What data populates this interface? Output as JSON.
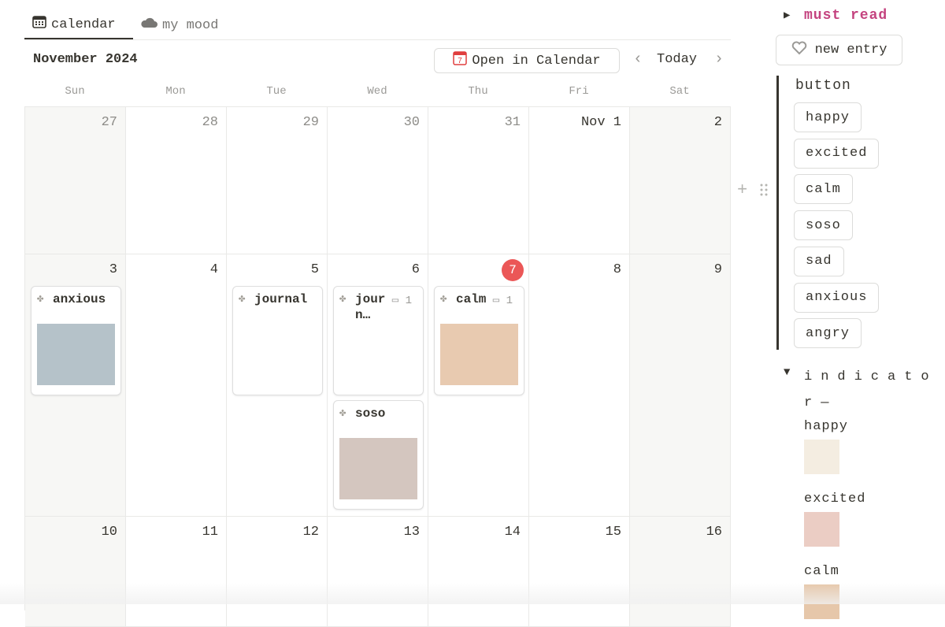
{
  "tabs": [
    {
      "label": "calendar",
      "icon": "calendar-icon",
      "active": true
    },
    {
      "label": "my mood",
      "icon": "cloud-icon",
      "active": false
    }
  ],
  "header": {
    "month": "November 2024",
    "open_label": "Open in Calendar",
    "today_label": "Today"
  },
  "weekdays": [
    "Sun",
    "Mon",
    "Tue",
    "Wed",
    "Thu",
    "Fri",
    "Sat"
  ],
  "weeks": [
    [
      "27",
      "28",
      "29",
      "30",
      "31",
      "Nov 1",
      "2"
    ],
    [
      "3",
      "4",
      "5",
      "6",
      "7",
      "8",
      "9"
    ],
    [
      "10",
      "11",
      "12",
      "13",
      "14",
      "15",
      "16"
    ]
  ],
  "today": "7",
  "entries": [
    {
      "title": "anxious",
      "color": "#b5c2c9"
    },
    {
      "title": "journal"
    },
    {
      "title": "journ…",
      "comments": "1"
    },
    {
      "title": "soso",
      "color": "#d4c6bf"
    },
    {
      "title": "calm",
      "comments": "1",
      "color": "#e8cab0"
    }
  ],
  "side": {
    "must_read": "must read",
    "must_read_color": "#c4437f",
    "new_entry": "new entry",
    "button_heading": "button",
    "moods": [
      "happy",
      "excited",
      "calm",
      "soso",
      "sad",
      "anxious",
      "angry"
    ],
    "indicator_heading": "indicator—",
    "indicators": [
      {
        "label": "happy",
        "color": "#f4ede1"
      },
      {
        "label": "excited",
        "color": "#ebcdc4"
      },
      {
        "label": "calm",
        "color": "#e6c7aa"
      }
    ]
  }
}
